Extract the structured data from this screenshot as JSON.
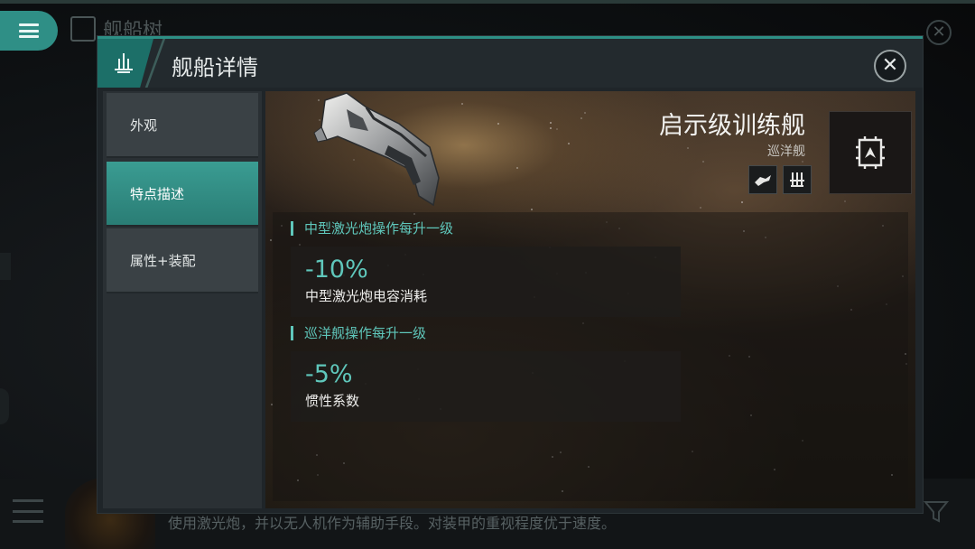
{
  "background": {
    "title": "舰船树",
    "description": "使用激光炮，并以无人机作为辅助手段。对装甲的重视程度优于速度。"
  },
  "dialog": {
    "title": "舰船详情",
    "close_icon": "close-icon",
    "accent_color": "#2d8f85"
  },
  "sidebar": {
    "tabs": [
      {
        "label": "外观",
        "active": false
      },
      {
        "label": "特点描述",
        "active": true
      },
      {
        "label": "属性+装配",
        "active": false
      }
    ]
  },
  "ship": {
    "name": "启示级训练舰",
    "class": "巡洋舰",
    "tags": [
      "drone-icon",
      "laser-turret-icon"
    ],
    "badge_icon": "ship-class-badge-icon"
  },
  "bonuses": [
    {
      "header": "中型激光炮操作每升一级",
      "value": "-10%",
      "label": "中型激光炮电容消耗"
    },
    {
      "header": "巡洋舰操作每升一级",
      "value": "-5%",
      "label": "惯性系数"
    }
  ],
  "colors": {
    "teal": "#5fc7bb",
    "active_tab": "#2f8f86"
  }
}
